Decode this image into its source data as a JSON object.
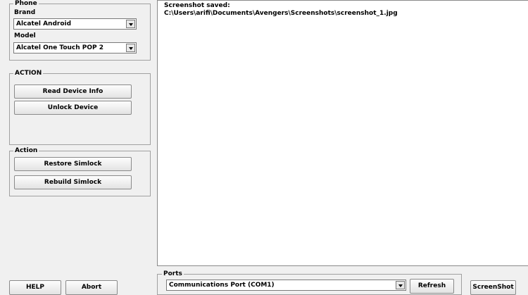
{
  "phone_group": {
    "title": "Phone",
    "brand_label": "Brand",
    "brand_value": "Alcatel Android",
    "model_label": "Model",
    "model_value": "Alcatel One Touch POP 2"
  },
  "action_group_1": {
    "title": "ACTION",
    "read_label": "Read Device Info",
    "unlock_label": "Unlock Device"
  },
  "action_group_2": {
    "title": "Action",
    "restore_label": "Restore Simlock",
    "rebuild_label": "Rebuild Simlock"
  },
  "log": {
    "lines": [
      "Screenshot saved:",
      "C:\\Users\\arifi\\Documents\\Avengers\\Screenshots\\screenshot_1.jpg"
    ]
  },
  "ports": {
    "title": "Ports",
    "value": "Communications Port (COM1)",
    "refresh_label": "Refresh"
  },
  "bottom": {
    "help_label": "HELP",
    "abort_label": "Abort",
    "screenshot_label": "ScreenShot"
  }
}
